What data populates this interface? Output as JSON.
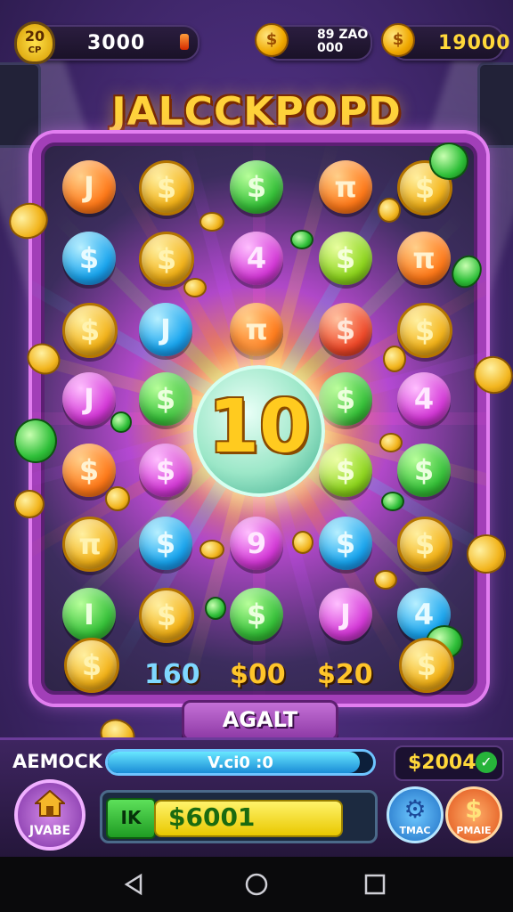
{
  "header": {
    "level_badge": "20",
    "level_sub": "CP",
    "score": "3000",
    "mid_coin_text_line1": "89 ZAO",
    "mid_coin_text_line2": "000",
    "coins": "19000"
  },
  "title": "JALCCKPOPD",
  "board": {
    "center_value": "10",
    "rows": [
      [
        {
          "c": "orange",
          "s": "J"
        },
        {
          "c": "gold",
          "s": "$"
        },
        {
          "c": "green",
          "s": "$"
        },
        {
          "c": "orange",
          "s": "π"
        },
        {
          "c": "gold",
          "s": "$"
        }
      ],
      [
        {
          "c": "blue",
          "s": "$"
        },
        {
          "c": "gold",
          "s": "$"
        },
        {
          "c": "purple",
          "s": "4"
        },
        {
          "c": "lime",
          "s": "$"
        },
        {
          "c": "orange",
          "s": "π"
        }
      ],
      [
        {
          "c": "gold",
          "s": "$"
        },
        {
          "c": "blue",
          "s": "J"
        },
        {
          "c": "orange",
          "s": "π"
        },
        {
          "c": "red",
          "s": "$"
        },
        {
          "c": "gold",
          "s": "$"
        }
      ],
      [
        {
          "c": "purple",
          "s": "J"
        },
        {
          "c": "green",
          "s": "$"
        },
        {
          "c": "none",
          "s": ""
        },
        {
          "c": "green",
          "s": "$"
        },
        {
          "c": "purple",
          "s": "4"
        }
      ],
      [
        {
          "c": "orange",
          "s": "$"
        },
        {
          "c": "purple",
          "s": "$"
        },
        {
          "c": "none",
          "s": ""
        },
        {
          "c": "lime",
          "s": "$"
        },
        {
          "c": "green",
          "s": "$"
        }
      ],
      [
        {
          "c": "gold",
          "s": "π"
        },
        {
          "c": "blue",
          "s": "$"
        },
        {
          "c": "purple",
          "s": "9"
        },
        {
          "c": "blue",
          "s": "$"
        },
        {
          "c": "gold",
          "s": "$"
        }
      ],
      [
        {
          "c": "green",
          "s": "I"
        },
        {
          "c": "gold",
          "s": "$"
        },
        {
          "c": "green",
          "s": "$"
        },
        {
          "c": "purple",
          "s": "J"
        },
        {
          "c": "blue",
          "s": "4"
        }
      ]
    ],
    "payouts": [
      "160",
      "$00",
      "$20"
    ],
    "payout_colors": [
      "#7fd8ff",
      "#ffc52a",
      "#ffc52a"
    ]
  },
  "again_button": "AGALT",
  "hud": {
    "label": "AEMOCK",
    "progress_text": "V.ci0 :0",
    "progress": 0.95,
    "wallet": "$2004",
    "home_label": "JVABE",
    "bet_tag": "IK",
    "bet_amount": "$6001",
    "settings_label": "TMAC",
    "pause_label": "PMAIE"
  },
  "colors": {
    "accent": "#a23fb8",
    "gold": "#ffd23a"
  }
}
